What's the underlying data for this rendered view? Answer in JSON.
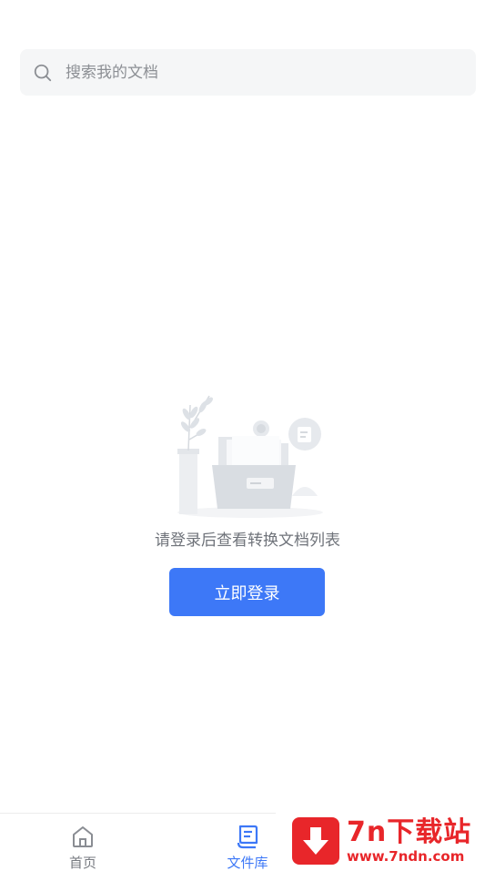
{
  "search": {
    "placeholder": "搜索我的文档"
  },
  "empty_state": {
    "message": "请登录后查看转换文档列表",
    "login_button": "立即登录"
  },
  "tabbar": {
    "items": [
      {
        "label": "首页",
        "icon": "home-icon",
        "active": false
      },
      {
        "label": "文件库",
        "icon": "document-icon",
        "active": true
      }
    ]
  },
  "watermark": {
    "title": "7n下载站",
    "url": "www.7ndn.com"
  },
  "colors": {
    "accent": "#3d78f7",
    "search_bg": "#f5f6f7",
    "watermark_red": "#e8262a"
  }
}
